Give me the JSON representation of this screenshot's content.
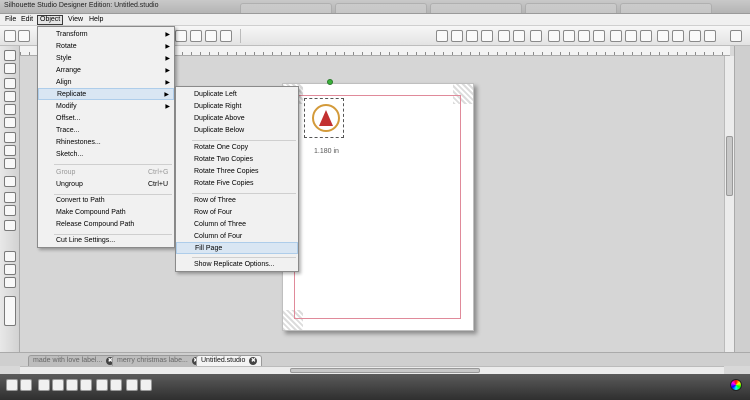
{
  "window": {
    "title": "Silhouette Studio Designer Edition: Untitled.studio"
  },
  "menubar": [
    "File",
    "Edit",
    "Object",
    "View",
    "Help"
  ],
  "object_menu": {
    "items": [
      {
        "label": "Transform",
        "submenu": true
      },
      {
        "label": "Rotate",
        "submenu": true
      },
      {
        "label": "Style",
        "submenu": true
      },
      {
        "label": "Arrange",
        "submenu": true
      },
      {
        "label": "Align",
        "submenu": true
      },
      {
        "label": "Replicate",
        "submenu": true,
        "highlighted": true
      },
      {
        "label": "Modify",
        "submenu": true
      },
      {
        "label": "Offset..."
      },
      {
        "label": "Trace..."
      },
      {
        "label": "Rhinestones..."
      },
      {
        "label": "Sketch..."
      },
      {
        "label": "Group",
        "shortcut": "Ctrl+G",
        "disabled": true
      },
      {
        "label": "Ungroup",
        "shortcut": "Ctrl+U"
      },
      {
        "label": "Convert to Path"
      },
      {
        "label": "Make Compound Path"
      },
      {
        "label": "Release Compound Path"
      },
      {
        "label": "Cut Line Settings..."
      }
    ]
  },
  "replicate_menu": {
    "items": [
      {
        "label": "Duplicate Left"
      },
      {
        "label": "Duplicate Right"
      },
      {
        "label": "Duplicate Above"
      },
      {
        "label": "Duplicate Below"
      },
      {
        "label": "Rotate One Copy"
      },
      {
        "label": "Rotate Two Copies"
      },
      {
        "label": "Rotate Three Copies"
      },
      {
        "label": "Rotate Five Copies"
      },
      {
        "label": "Row of Three"
      },
      {
        "label": "Row of Four"
      },
      {
        "label": "Column of Three"
      },
      {
        "label": "Column of Four"
      },
      {
        "label": "Fill Page",
        "highlighted": true
      },
      {
        "label": "Show Replicate Options..."
      }
    ]
  },
  "canvas": {
    "dimension_label": "1.180 in"
  },
  "doc_tabs": [
    {
      "label": "made with love label...",
      "active": false
    },
    {
      "label": "merry christmas labe...",
      "active": false
    },
    {
      "label": "Untitled.studio",
      "active": true
    }
  ],
  "icons": {
    "tab_close": "✖",
    "submenu_arrow": "▶"
  }
}
